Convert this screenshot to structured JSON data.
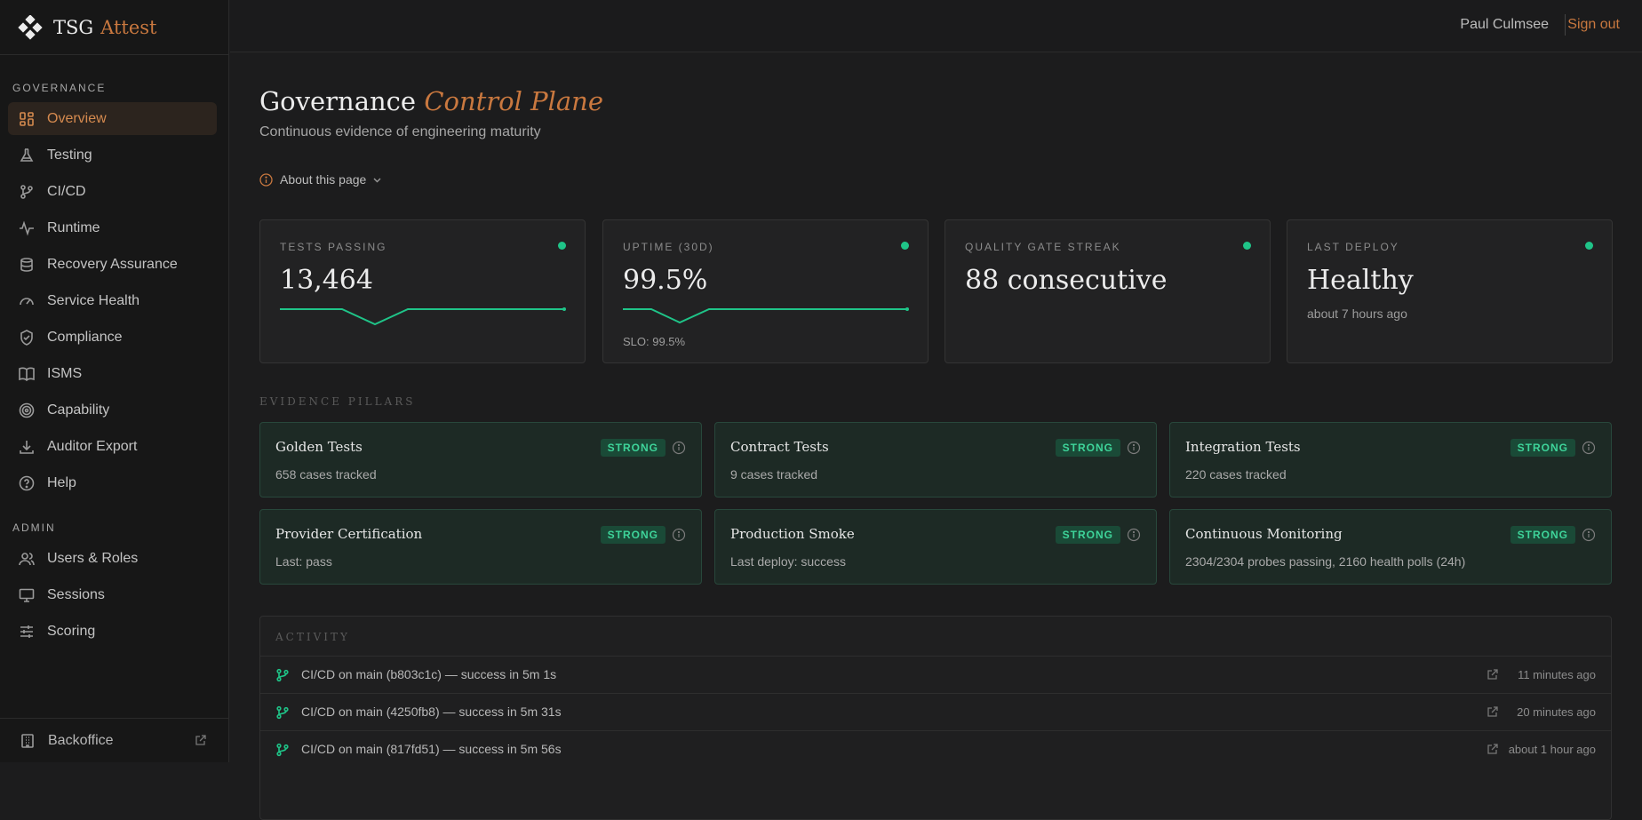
{
  "brand": {
    "name": "TSG",
    "accent": "Attest",
    "logo_icon": "diamond-logo-icon"
  },
  "sidebar": {
    "section_governance": "GOVERNANCE",
    "section_admin": "ADMIN",
    "items": [
      {
        "label": "Overview",
        "icon": "grid-icon",
        "active": true
      },
      {
        "label": "Testing",
        "icon": "flask-icon"
      },
      {
        "label": "CI/CD",
        "icon": "git-branch-icon"
      },
      {
        "label": "Runtime",
        "icon": "activity-icon"
      },
      {
        "label": "Recovery Assurance",
        "icon": "database-icon"
      },
      {
        "label": "Service Health",
        "icon": "gauge-icon"
      },
      {
        "label": "Compliance",
        "icon": "shield-check-icon"
      },
      {
        "label": "ISMS",
        "icon": "book-icon"
      },
      {
        "label": "Capability",
        "icon": "target-icon"
      },
      {
        "label": "Auditor Export",
        "icon": "download-icon"
      },
      {
        "label": "Help",
        "icon": "help-icon"
      }
    ],
    "admin_items": [
      {
        "label": "Users & Roles",
        "icon": "users-icon"
      },
      {
        "label": "Sessions",
        "icon": "monitor-icon"
      },
      {
        "label": "Scoring",
        "icon": "sliders-icon"
      }
    ],
    "backoffice": "Backoffice"
  },
  "header": {
    "user": "Paul Culmsee",
    "signout": "Sign out"
  },
  "page": {
    "title": "Governance",
    "title_accent": "Control Plane",
    "subtitle": "Continuous evidence of engineering maturity",
    "about": "About this page"
  },
  "kpis": [
    {
      "label": "TESTS PASSING",
      "value": "13,464",
      "status_color": "#1fc488"
    },
    {
      "label": "UPTIME (30D)",
      "value": "99.5%",
      "note": "SLO: 99.5%",
      "status_color": "#1fc488"
    },
    {
      "label": "QUALITY GATE STREAK",
      "value": "88 consecutive",
      "status_color": "#1fc488"
    },
    {
      "label": "LAST DEPLOY",
      "value": "Healthy",
      "sub": "about 7 hours ago",
      "status_color": "#1fc488"
    }
  ],
  "pillars_label": "EVIDENCE PILLARS",
  "pillars": [
    {
      "name": "Golden Tests",
      "badge": "STRONG",
      "desc": "658 cases tracked"
    },
    {
      "name": "Contract Tests",
      "badge": "STRONG",
      "desc": "9 cases tracked"
    },
    {
      "name": "Integration Tests",
      "badge": "STRONG",
      "desc": "220 cases tracked"
    },
    {
      "name": "Provider Certification",
      "badge": "STRONG",
      "desc": "Last: pass"
    },
    {
      "name": "Production Smoke",
      "badge": "STRONG",
      "desc": "Last deploy: success"
    },
    {
      "name": "Continuous Monitoring",
      "badge": "STRONG",
      "desc": "2304/2304 probes passing, 2160 health polls (24h)"
    }
  ],
  "activity": {
    "label": "ACTIVITY",
    "rows": [
      {
        "text": "CI/CD on main (b803c1c) — success in 5m 1s",
        "time": "11 minutes ago"
      },
      {
        "text": "CI/CD on main (4250fb8) — success in 5m 31s",
        "time": "20 minutes ago"
      },
      {
        "text": "CI/CD on main (817fd51) — success in 5m 56s",
        "time": "about 1 hour ago"
      }
    ]
  },
  "colors": {
    "accent": "#c9783f",
    "success": "#1fc488",
    "strong_badge_bg": "#1a4a37"
  }
}
